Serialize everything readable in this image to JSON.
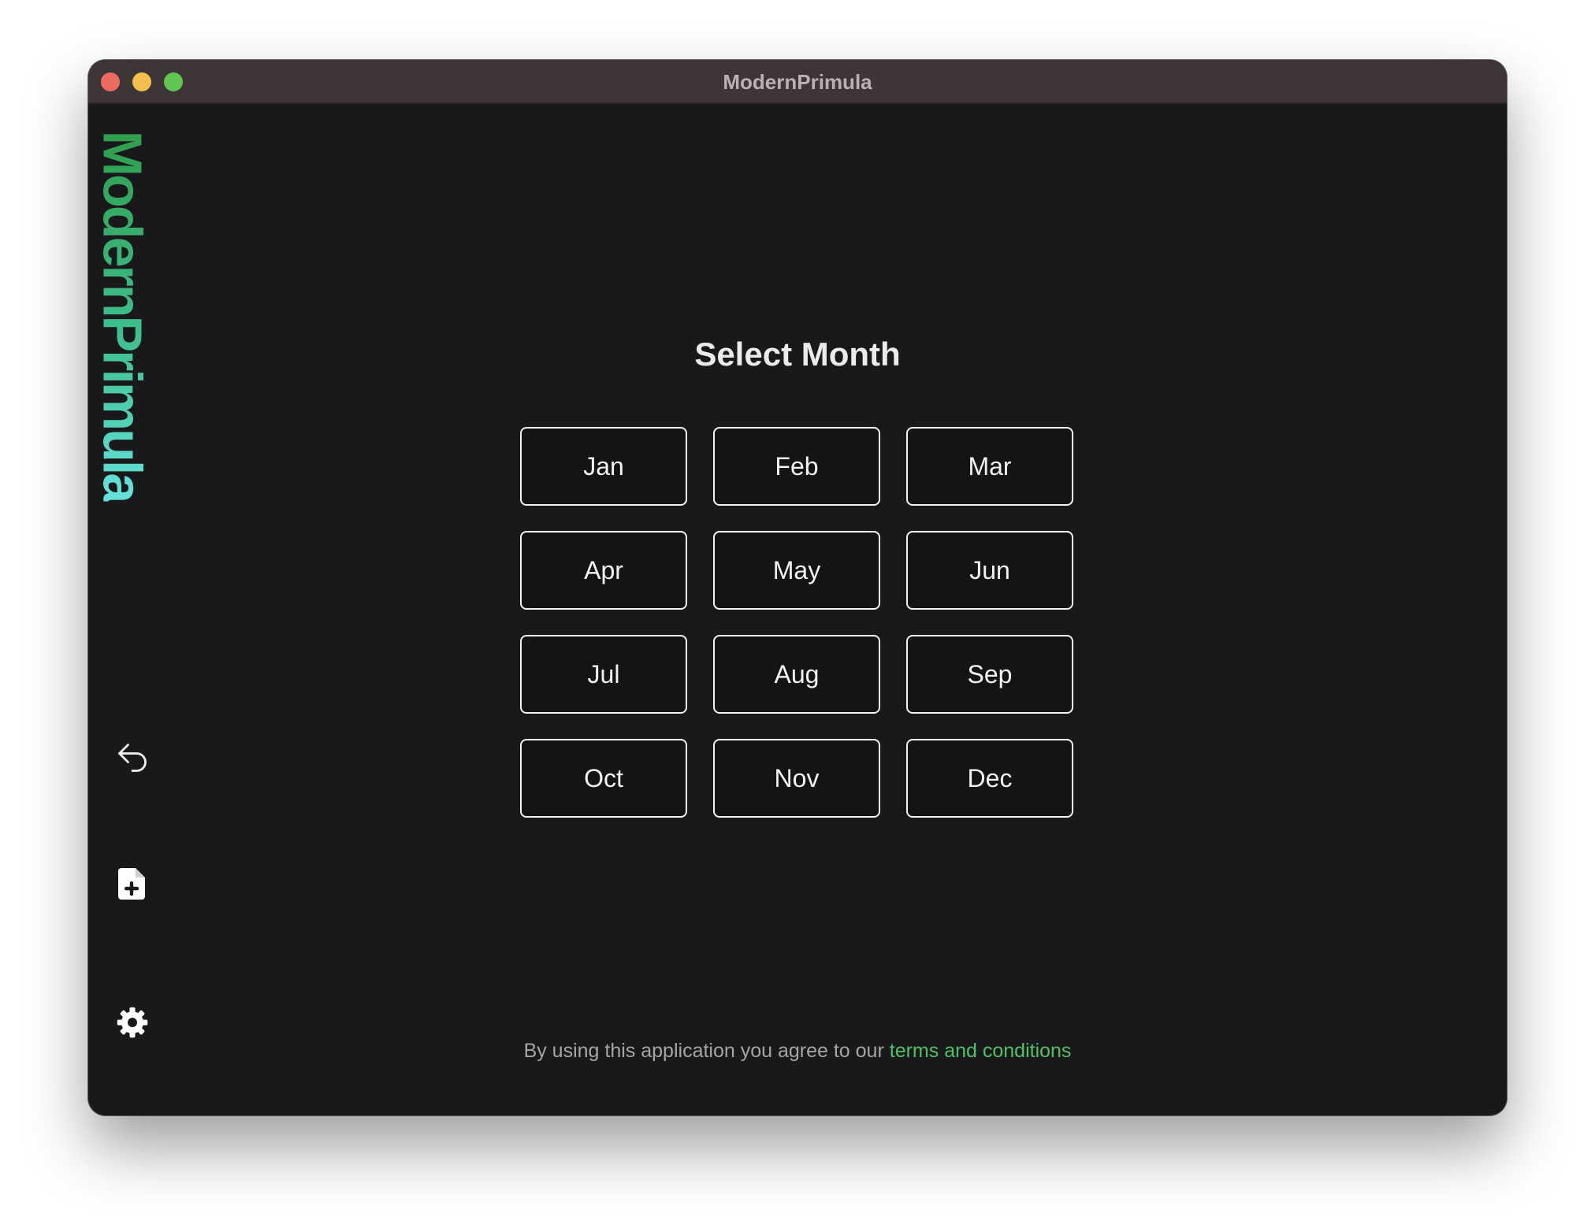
{
  "window": {
    "title": "ModernPrimula"
  },
  "sidebar": {
    "logo_text": "ModernPrimula",
    "buttons": [
      {
        "icon": "undo-icon"
      },
      {
        "icon": "file-plus-icon"
      },
      {
        "icon": "gear-icon"
      }
    ]
  },
  "main": {
    "title": "Select Month",
    "months": [
      "Jan",
      "Feb",
      "Mar",
      "Apr",
      "May",
      "Jun",
      "Jul",
      "Aug",
      "Sep",
      "Oct",
      "Nov",
      "Dec"
    ]
  },
  "footer": {
    "text": "By using this application you agree to our ",
    "link_text": "terms and conditions"
  },
  "colors": {
    "background": "#19191b",
    "titlebar": "#3e3636",
    "accent_green": "#4fc165",
    "logo_gradient": [
      "#2f9e4c",
      "#66e2dc"
    ],
    "traffic_close": "#ed6a5e",
    "traffic_minimize": "#f5bf4f",
    "traffic_maximize": "#61c554"
  }
}
